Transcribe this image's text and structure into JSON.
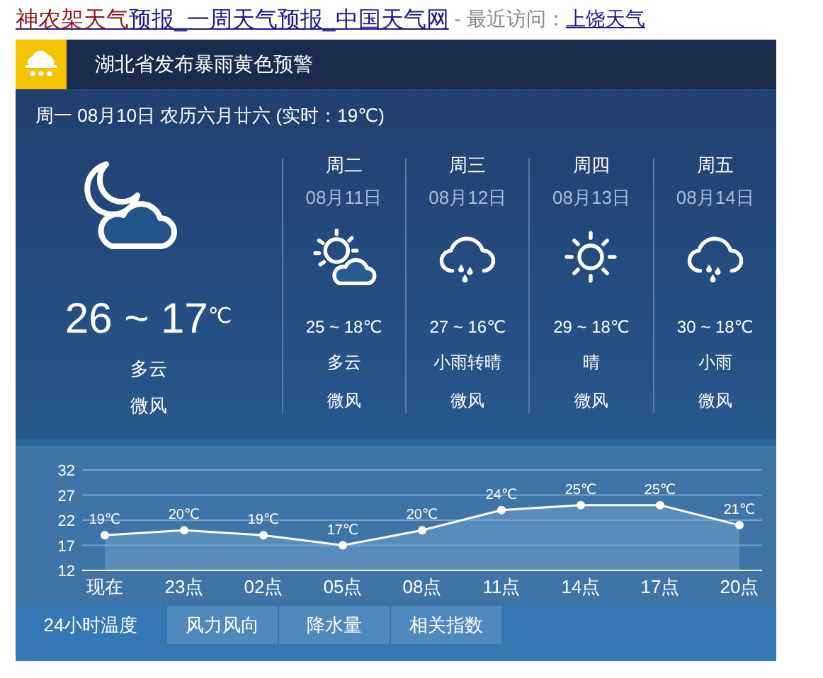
{
  "title": {
    "highlight": "神农架天气",
    "rest": "预报_一周天气预报_中国天气网",
    "separator": "- 最近访问：",
    "recent": "上饶天气"
  },
  "alert": {
    "text": "湖北省发布暴雨黄色预警"
  },
  "today": {
    "date_line": "周一 08月10日 农历六月廿六 (实时：19℃)",
    "kind": "night_cloudy",
    "temp": "26 ~ 17",
    "unit": "℃",
    "weather": "多云",
    "wind": "微风"
  },
  "days": [
    {
      "day": "周二",
      "date": "08月11日",
      "kind": "partly_cloudy",
      "temp": "25 ~ 18℃",
      "weather": "多云",
      "wind": "微风"
    },
    {
      "day": "周三",
      "date": "08月12日",
      "kind": "rain",
      "temp": "27 ~ 16℃",
      "weather": "小雨转晴",
      "wind": "微风"
    },
    {
      "day": "周四",
      "date": "08月13日",
      "kind": "sunny",
      "temp": "29 ~ 18℃",
      "weather": "晴",
      "wind": "微风"
    },
    {
      "day": "周五",
      "date": "08月14日",
      "kind": "rain",
      "temp": "30 ~ 18℃",
      "weather": "小雨",
      "wind": "微风"
    }
  ],
  "chart_data": {
    "type": "line",
    "categories": [
      "现在",
      "23点",
      "02点",
      "05点",
      "08点",
      "11点",
      "14点",
      "17点",
      "20点"
    ],
    "ylim": [
      12,
      32
    ],
    "yticks": [
      12,
      17,
      22,
      27,
      32
    ],
    "grid": true,
    "series": [
      {
        "color": "#ffffff",
        "marker": "circle",
        "values": [
          19,
          20,
          19,
          17,
          20,
          24,
          25,
          25,
          21
        ]
      }
    ],
    "value_labels": [
      "19℃",
      "20℃",
      "19℃",
      "17℃",
      "20℃",
      "24℃",
      "25℃",
      "25℃",
      "21℃"
    ]
  },
  "tabs": [
    {
      "label": "24小时温度",
      "selected": true
    },
    {
      "label": "风力风向",
      "selected": false
    },
    {
      "label": "降水量",
      "selected": false
    },
    {
      "label": "相关指数",
      "selected": false
    }
  ]
}
